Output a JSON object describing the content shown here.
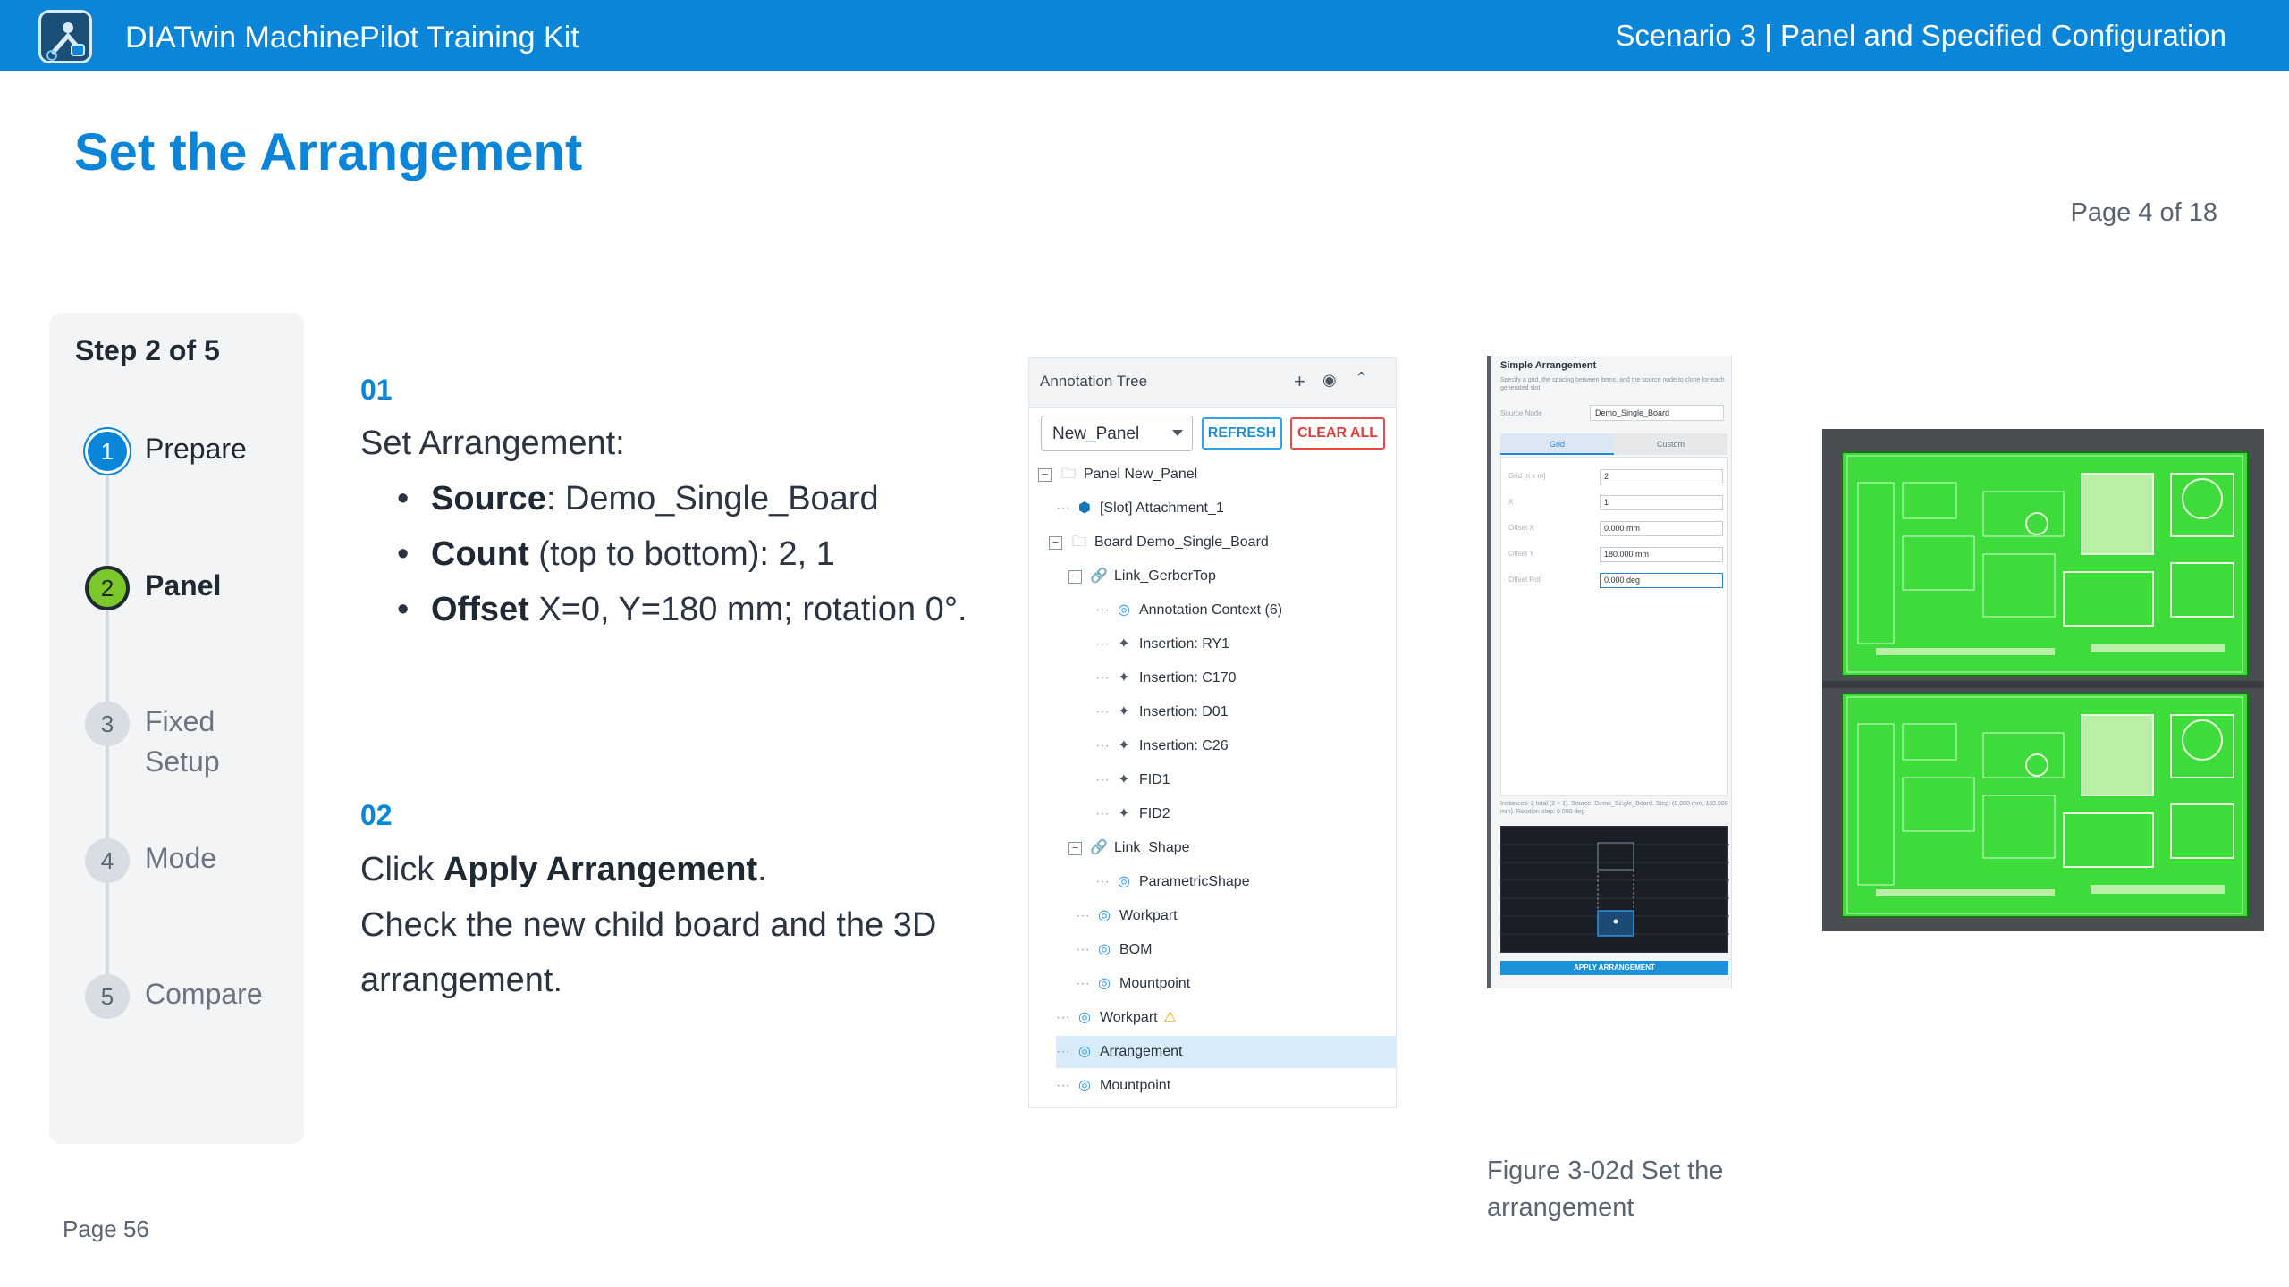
{
  "header": {
    "app_title": "DIATwin MachinePilot Training Kit",
    "scenario": "Scenario 3 | Panel and Specified Configuration"
  },
  "page": {
    "title": "Set the Arrangement",
    "page_of": "Page 4 of 18",
    "footer": "Page 56"
  },
  "stepper": {
    "title": "Step 2 of 5",
    "steps": [
      {
        "number": "1",
        "label": "Prepare",
        "state": "done"
      },
      {
        "number": "2",
        "label": "Panel",
        "state": "active"
      },
      {
        "number": "3",
        "label": "Fixed Setup",
        "state": "pending"
      },
      {
        "number": "4",
        "label": "Mode",
        "state": "pending"
      },
      {
        "number": "5",
        "label": "Compare",
        "state": "pending"
      }
    ]
  },
  "instructions": {
    "step1_number": "01",
    "step1_heading": "Set Arrangement:",
    "bullets": [
      {
        "key": "Source",
        "text": ": Demo_Single_Board"
      },
      {
        "key": "Count",
        "text": " (top to bottom): 2, 1"
      },
      {
        "key": "Offset",
        "text": " X=0, Y=180 mm; rotation 0°."
      }
    ],
    "step2_number": "02",
    "step2_prefix": "Click ",
    "step2_bold": "Apply Arrangement",
    "step2_suffix": ".",
    "step2_line2": "Check the new child board and the 3D arrangement."
  },
  "annotation_tree": {
    "title": "Annotation Tree",
    "selected_panel": "New_Panel",
    "refresh_label": "REFRESH",
    "clear_label": "CLEAR ALL",
    "nodes": [
      {
        "label": "Panel  New_Panel",
        "icon": "folder-icon"
      },
      {
        "label": "[Slot] Attachment_1",
        "icon": "cube-icon"
      },
      {
        "label": "Board  Demo_Single_Board",
        "icon": "folder-icon"
      },
      {
        "label": "Link_GerberTop",
        "icon": "link-icon"
      },
      {
        "label": "Annotation Context (6)",
        "icon": "context-icon"
      },
      {
        "label": "Insertion: RY1",
        "icon": "insertion-icon"
      },
      {
        "label": "Insertion: C170",
        "icon": "insertion-icon"
      },
      {
        "label": "Insertion: D01",
        "icon": "insertion-icon"
      },
      {
        "label": "Insertion: C26",
        "icon": "insertion-icon"
      },
      {
        "label": "FID1",
        "icon": "insertion-icon"
      },
      {
        "label": "FID2",
        "icon": "insertion-icon"
      },
      {
        "label": "Link_Shape",
        "icon": "link-icon"
      },
      {
        "label": "ParametricShape",
        "icon": "context-icon"
      },
      {
        "label": "Workpart",
        "icon": "context-icon"
      },
      {
        "label": "BOM",
        "icon": "context-icon"
      },
      {
        "label": "Mountpoint",
        "icon": "context-icon"
      },
      {
        "label": "Workpart",
        "icon": "context-icon",
        "warning": true
      },
      {
        "label": "Arrangement",
        "icon": "context-icon",
        "selected": true
      },
      {
        "label": "Mountpoint",
        "icon": "context-icon"
      }
    ]
  },
  "simple_arrangement": {
    "title": "Simple Arrangement",
    "description": "Specify a grid, the spacing between items, and the source node to clone for each generated slot.",
    "source_label": "Source Node",
    "source_value": "Demo_Single_Board",
    "tab_grid": "Grid",
    "tab_custom": "Custom",
    "fields": [
      {
        "label": "Grid [n x m]",
        "value": "2"
      },
      {
        "label": "X",
        "value": "1"
      },
      {
        "label": "Offset X",
        "value": "0.000 mm"
      },
      {
        "label": "Offset Y",
        "value": "180.000 mm"
      },
      {
        "label": "Offset Rot",
        "value": "0.000 deg"
      }
    ],
    "info": "Instances: 2 total (2 × 1). Source: Demo_Single_Board. Step: (0.000 mm, 180.000 mm). Rotation step: 0.000 deg",
    "apply_label": "APPLY ARRANGEMENT"
  },
  "figure": {
    "caption": "Figure 3-02d  Set the arrangement"
  },
  "colors": {
    "brand_blue": "#0a85d8",
    "active_green": "#7cc72b",
    "pcb_green": "#3ddc3a"
  }
}
